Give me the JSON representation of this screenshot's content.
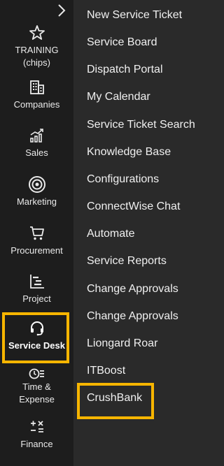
{
  "sidebar": {
    "items": [
      {
        "label_line1": "TRAINING",
        "label_line2": "(chips)",
        "icon": "star-icon"
      },
      {
        "label": "Companies",
        "icon": "building-icon"
      },
      {
        "label": "Sales",
        "icon": "sales-chart-icon"
      },
      {
        "label": "Marketing",
        "icon": "target-icon"
      },
      {
        "label": "Procurement",
        "icon": "cart-icon"
      },
      {
        "label": "Project",
        "icon": "gantt-icon"
      },
      {
        "label": "Service Desk",
        "icon": "headset-icon"
      },
      {
        "label_line1": "Time &",
        "label_line2": "Expense",
        "icon": "clock-list-icon"
      },
      {
        "label": "Finance",
        "icon": "math-icon"
      }
    ]
  },
  "flyout": {
    "items": [
      "New Service Ticket",
      "Service Board",
      "Dispatch Portal",
      "My Calendar",
      "Service Ticket Search",
      "Knowledge Base",
      "Configurations",
      "ConnectWise Chat",
      "Automate",
      "Service Reports",
      "Change Approvals",
      "Change Approvals",
      "Liongard Roar",
      "ITBoost",
      "CrushBank"
    ]
  },
  "colors": {
    "highlight": "#f7b500",
    "sidebar_bg": "#1d1d1d",
    "flyout_bg": "#2a2a2a"
  }
}
